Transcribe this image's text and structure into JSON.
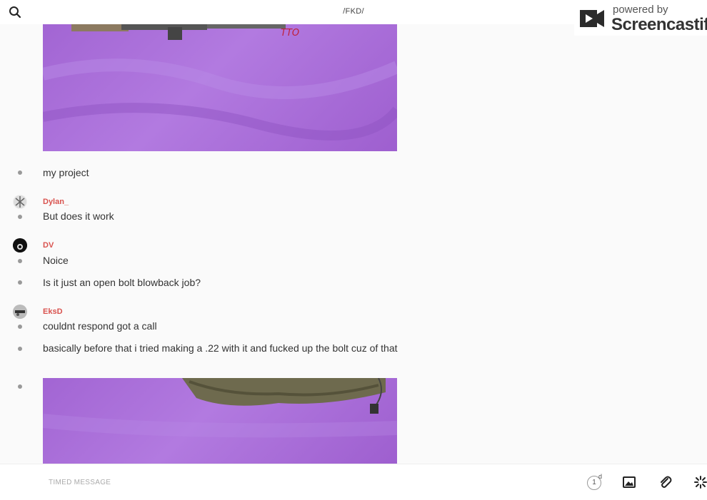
{
  "header": {
    "channel_title": "/FKD/",
    "search_icon": "search-icon"
  },
  "watermark": {
    "line1": "powered by",
    "line2": "Screencastify"
  },
  "messages": [
    {
      "text": "my project"
    },
    {
      "author": "Dylan_",
      "text": "But does it work"
    },
    {
      "author": "DV",
      "text": "Noice"
    },
    {
      "text": "Is it just an open bolt blowback job?"
    },
    {
      "author": "EksD",
      "text": "couldnt respond got a call"
    },
    {
      "text": "basically before that i tried making a .22 with it and fucked up the bolt cuz of that"
    }
  ],
  "composer": {
    "placeholder": "TIMED MESSAGE",
    "timer_value": "1",
    "timer_unit": "d"
  },
  "colors": {
    "author": "#d9534f",
    "background": "#fafafa",
    "image_purple": "#a265d3"
  }
}
